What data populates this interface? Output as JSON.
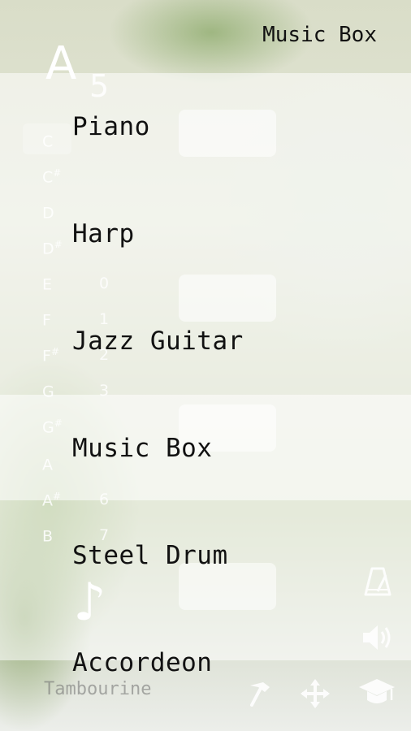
{
  "header": {
    "title": "Music Box"
  },
  "current_note": {
    "letter": "A",
    "octave": "5"
  },
  "notes": [
    {
      "label": "C",
      "sharp": ""
    },
    {
      "label": "C",
      "sharp": "#"
    },
    {
      "label": "D",
      "sharp": ""
    },
    {
      "label": "D",
      "sharp": "#"
    },
    {
      "label": "E",
      "sharp": ""
    },
    {
      "label": "F",
      "sharp": ""
    },
    {
      "label": "F",
      "sharp": "#"
    },
    {
      "label": "G",
      "sharp": ""
    },
    {
      "label": "G",
      "sharp": "#"
    },
    {
      "label": "A",
      "sharp": ""
    },
    {
      "label": "A",
      "sharp": "#"
    },
    {
      "label": "B",
      "sharp": ""
    }
  ],
  "octaves": [
    "0",
    "1",
    "2",
    "3",
    "",
    "6",
    "7"
  ],
  "instruments": [
    {
      "label": "Piano",
      "selected": false
    },
    {
      "label": "Harp",
      "selected": false
    },
    {
      "label": "Jazz Guitar",
      "selected": false
    },
    {
      "label": "Music Box",
      "selected": true
    },
    {
      "label": "Steel Drum",
      "selected": false
    },
    {
      "label": "Accordeon",
      "selected": false
    }
  ],
  "background_instrument": "Tambourine",
  "icons": [
    "metronome-icon",
    "volume-icon",
    "hammer-icon",
    "move-icon",
    "graduation-cap-icon",
    "music-note-icon"
  ]
}
